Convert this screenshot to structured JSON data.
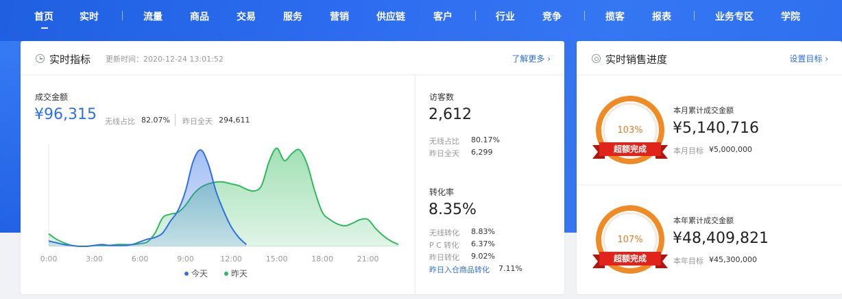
{
  "nav": {
    "items": [
      "首页",
      "实时",
      "流量",
      "商品",
      "交易",
      "服务",
      "营销",
      "供应链",
      "客户",
      "行业",
      "竞争",
      "揽客",
      "报表",
      "业务专区",
      "学院"
    ]
  },
  "realtime": {
    "title": "实时指标",
    "update_time": "更新时间：2020-12-24 13:01:52",
    "more_link": "了解更多 ›",
    "gmv_label": "成交金额",
    "gmv_value": "¥96,315",
    "wireless_label": "无线占比",
    "wireless_value": "82.07%",
    "yesterday_label": "昨日全天",
    "yesterday_value": "294,611",
    "visitors_label": "访客数",
    "visitors_value": "2,612",
    "v_wireless_label": "无线占比",
    "v_wireless_value": "80.17%",
    "v_yesterday_label": "昨日全天",
    "v_yesterday_value": "6,299",
    "conv_label": "转化率",
    "conv_value": "8.35%",
    "c_wireless_label": "无线转化",
    "c_wireless_value": "8.83%",
    "c_pc_label": "P C 转化",
    "c_pc_value": "6.37%",
    "c_yesterday_label": "昨日转化",
    "c_yesterday_value": "9.02%",
    "c_cart_label": "昨日入仓商品转化",
    "c_cart_value": "7.11%"
  },
  "chart_data": {
    "type": "area",
    "x_ticks": [
      "0:00",
      "3:00",
      "6:00",
      "9:00",
      "12:00",
      "15:00",
      "18:00",
      "21:00"
    ],
    "x": [
      0,
      0.5,
      1,
      1.5,
      2,
      2.5,
      3,
      3.5,
      4,
      4.5,
      5,
      5.5,
      6,
      6.5,
      7,
      7.5,
      8,
      8.5,
      9,
      9.5,
      10,
      10.5,
      11,
      11.5,
      12,
      12.5,
      13,
      13.5,
      14,
      14.5,
      15,
      15.5,
      16,
      16.5,
      17,
      17.5,
      18,
      18.5,
      19,
      19.5,
      20,
      20.5,
      21,
      21.5,
      22,
      22.5,
      23
    ],
    "series": [
      {
        "name": "今天",
        "color": "#2f6fe4",
        "values": [
          6,
          4,
          2,
          1,
          0,
          0,
          1,
          2,
          1,
          1,
          1,
          2,
          5,
          8,
          10,
          15,
          28,
          40,
          62,
          95,
          108,
          92,
          62,
          40,
          22,
          10,
          2,
          null,
          null,
          null,
          null,
          null,
          null,
          null,
          null,
          null,
          null,
          null,
          null,
          null,
          null,
          null,
          null,
          null,
          null,
          null,
          null
        ]
      },
      {
        "name": "昨天",
        "color": "#2fb95a",
        "values": [
          14,
          8,
          4,
          1,
          0,
          0,
          1,
          1,
          1,
          2,
          2,
          2,
          3,
          5,
          15,
          32,
          36,
          38,
          46,
          58,
          66,
          70,
          72,
          72,
          70,
          68,
          64,
          62,
          68,
          95,
          110,
          96,
          104,
          108,
          92,
          62,
          38,
          30,
          25,
          23,
          26,
          30,
          30,
          20,
          12,
          6,
          2
        ]
      }
    ],
    "xlabel": "",
    "ylabel": "",
    "legend_position": "bottom",
    "grid": false
  },
  "sales": {
    "title": "实时销售进度",
    "set_link": "设置目标 ›",
    "month": {
      "pct": "103%",
      "badge": "超额完成",
      "label": "本月累计成交金额",
      "value": "¥5,140,716",
      "target_label": "本月目标",
      "target_value": "¥5,000,000"
    },
    "year": {
      "pct": "107%",
      "badge": "超额完成",
      "label": "本年累计成交金额",
      "value": "¥48,409,821",
      "target_label": "本年目标",
      "target_value": "¥45,300,000"
    }
  }
}
